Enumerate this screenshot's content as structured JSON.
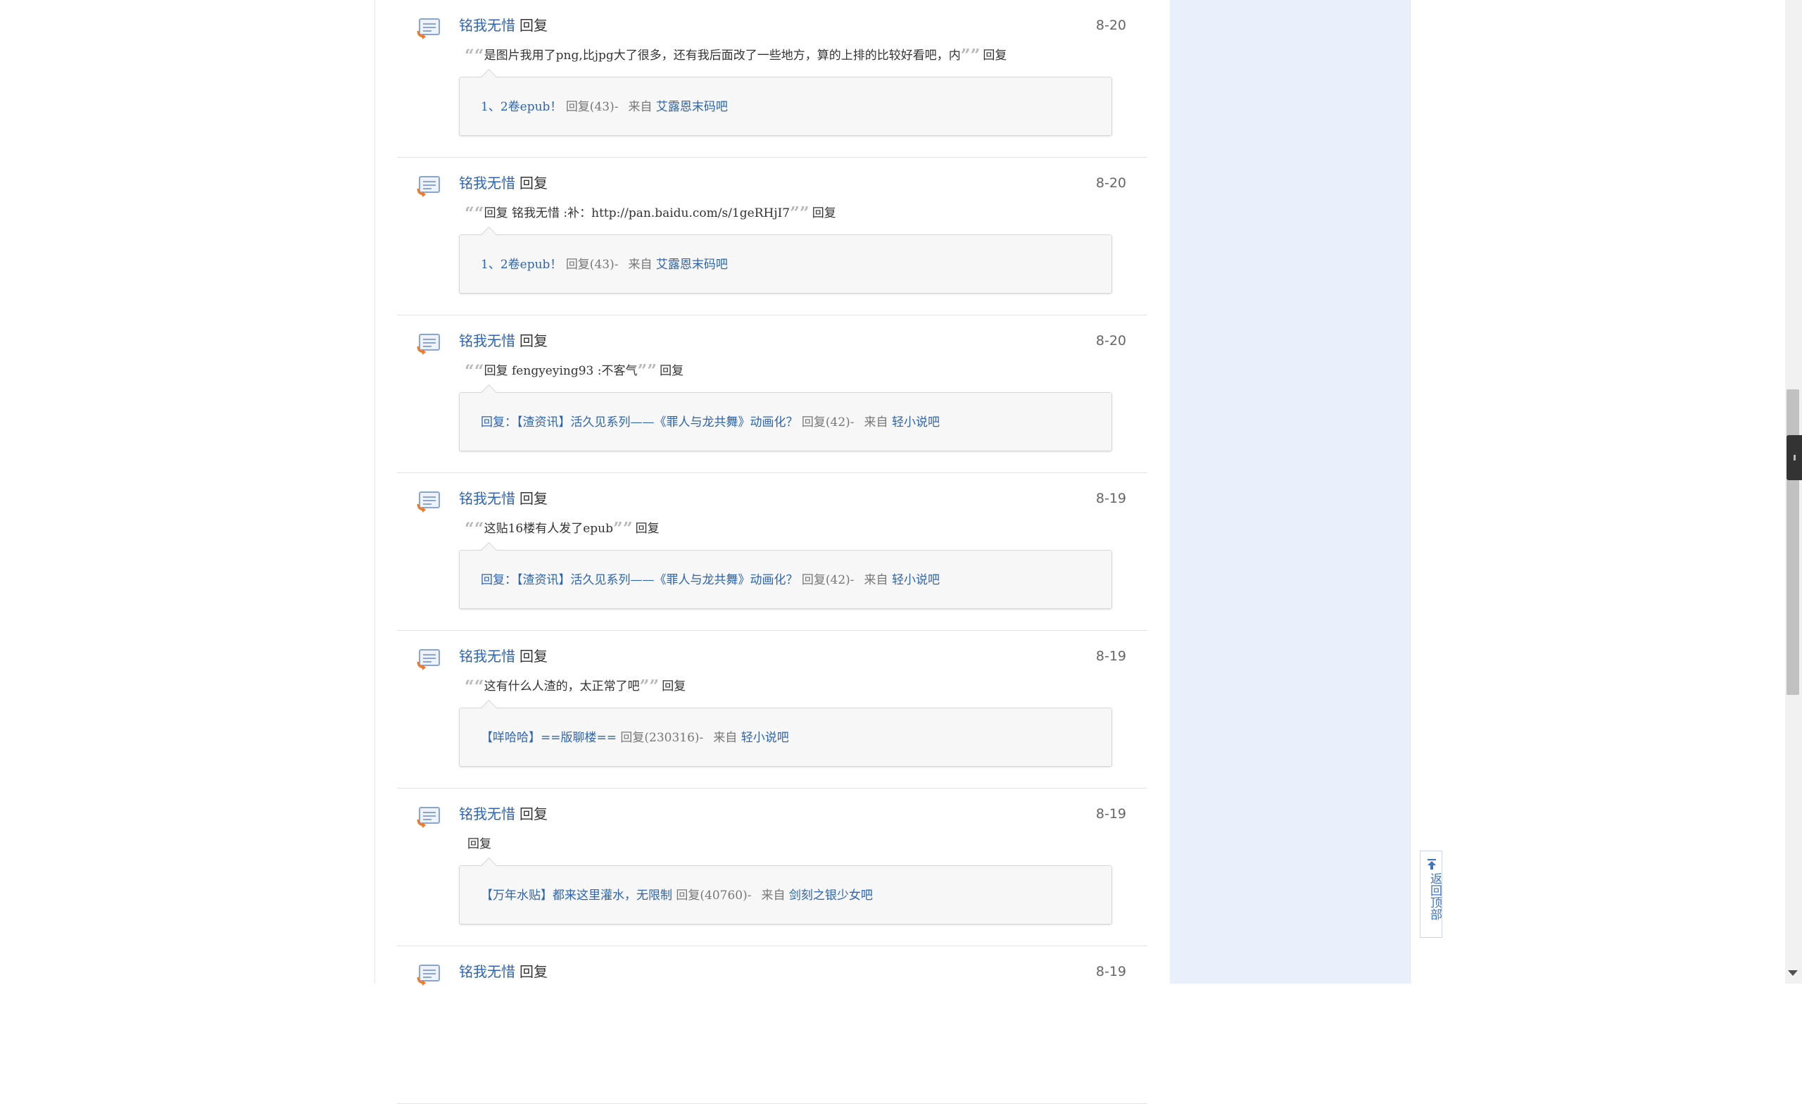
{
  "feed": {
    "items": [
      {
        "user": "铭我无惜",
        "action": "回复",
        "date": "8-20",
        "quote": "是图片我用了png,比jpg大了很多，还有我后面改了一些地方，算的上排的比较好看吧，内",
        "reply_label": "回复",
        "card": {
          "title": "1、2卷epub！",
          "meta": "回复(43)-",
          "from_label": "来自",
          "forum": "艾露恩末码吧"
        }
      },
      {
        "user": "铭我无惜",
        "action": "回复",
        "date": "8-20",
        "quote": "回复 铭我无惜 :补：http://pan.baidu.com/s/1geRHjI7",
        "reply_label": "回复",
        "card": {
          "title": "1、2卷epub！",
          "meta": "回复(43)-",
          "from_label": "来自",
          "forum": "艾露恩末码吧"
        }
      },
      {
        "user": "铭我无惜",
        "action": "回复",
        "date": "8-20",
        "quote": "回复 fengyeying93 :不客气",
        "reply_label": "回复",
        "card": {
          "title": "回复：【渣资讯】活久见系列——《罪人与龙共舞》动画化？",
          "meta": "回复(42)-",
          "from_label": "来自",
          "forum": "轻小说吧"
        }
      },
      {
        "user": "铭我无惜",
        "action": "回复",
        "date": "8-19",
        "quote": "这贴16楼有人发了epub",
        "reply_label": "回复",
        "card": {
          "title": "回复：【渣资讯】活久见系列——《罪人与龙共舞》动画化？",
          "meta": "回复(42)-",
          "from_label": "来自",
          "forum": "轻小说吧"
        }
      },
      {
        "user": "铭我无惜",
        "action": "回复",
        "date": "8-19",
        "quote": "这有什么人渣的，太正常了吧",
        "reply_label": "回复",
        "card": {
          "title": "【咩哈哈】==版聊楼==",
          "meta": "回复(230316)-",
          "from_label": "来自",
          "forum": "轻小说吧"
        }
      },
      {
        "user": "铭我无惜",
        "action": "回复",
        "date": "8-19",
        "quote": "",
        "reply_label": "回复",
        "card": {
          "title": "【万年水贴】都来这里灌水，无限制",
          "meta": "回复(40760)-",
          "from_label": "来自",
          "forum": "剑刻之银少女吧"
        }
      },
      {
        "user": "铭我无惜",
        "action": "回复",
        "date": "8-19",
        "quote": "",
        "reply_label": "",
        "card": null
      }
    ]
  },
  "back_to_top": {
    "label": "返回顶部",
    "icon": "arrow-up-to-top-icon"
  },
  "colors": {
    "link": "#2d64b3",
    "side_panel": "#e9f0fb",
    "card_bg": "#f7f7f7"
  }
}
